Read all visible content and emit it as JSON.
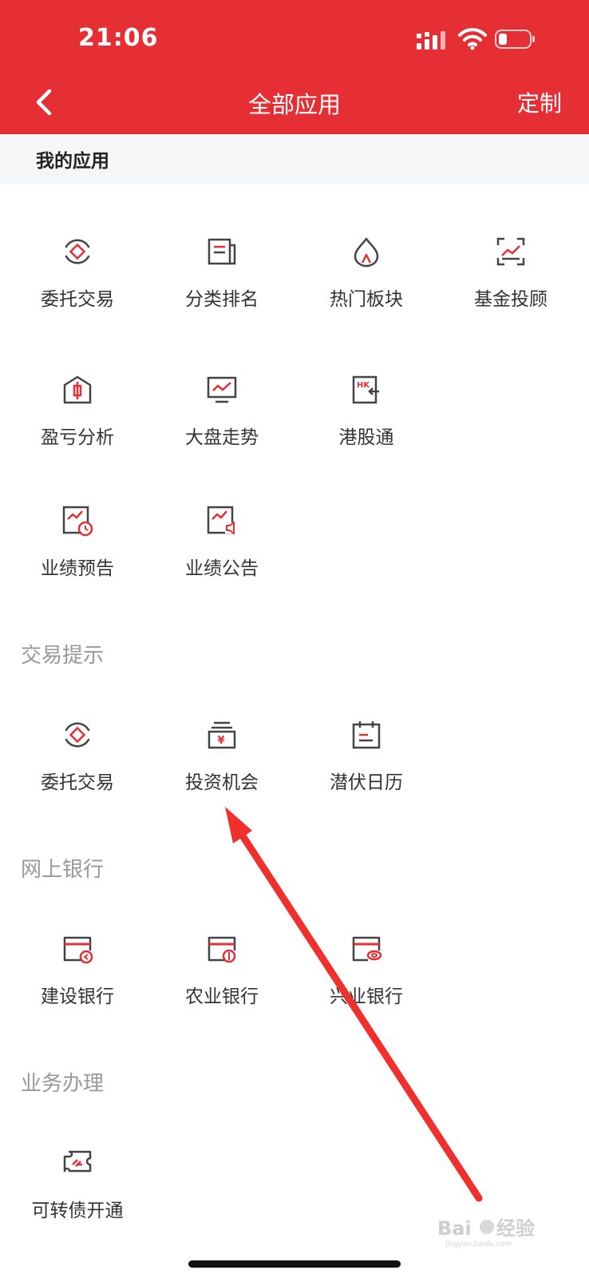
{
  "status": {
    "time": "21:06"
  },
  "header": {
    "title": "全部应用",
    "action": "定制"
  },
  "my_apps": {
    "title": "我的应用",
    "items": [
      {
        "label": "委托交易",
        "icon": "entrust-icon"
      },
      {
        "label": "分类排名",
        "icon": "ranking-icon"
      },
      {
        "label": "热门板块",
        "icon": "hot-sector-icon"
      },
      {
        "label": "基金投顾",
        "icon": "fund-advisor-icon"
      },
      {
        "label": "盈亏分析",
        "icon": "profit-analysis-icon"
      },
      {
        "label": "大盘走势",
        "icon": "market-trend-icon"
      },
      {
        "label": "港股通",
        "icon": "hk-connect-icon"
      },
      {
        "label": "业绩预告",
        "icon": "earnings-forecast-icon"
      },
      {
        "label": "业绩公告",
        "icon": "earnings-announcement-icon"
      }
    ]
  },
  "trade_tips": {
    "title": "交易提示",
    "items": [
      {
        "label": "委托交易",
        "icon": "entrust-icon"
      },
      {
        "label": "投资机会",
        "icon": "investment-opportunity-icon"
      },
      {
        "label": "潜伏日历",
        "icon": "calendar-icon"
      }
    ]
  },
  "online_banking": {
    "title": "网上银行",
    "items": [
      {
        "label": "建设银行",
        "icon": "ccb-card-icon"
      },
      {
        "label": "农业银行",
        "icon": "abc-card-icon"
      },
      {
        "label": "兴业银行",
        "icon": "cib-card-icon"
      }
    ]
  },
  "business": {
    "title": "业务办理",
    "items": [
      {
        "label": "可转债开通",
        "icon": "convertible-bond-icon"
      }
    ]
  },
  "watermark": {
    "text": "Baidu经验",
    "sub": "jingyan.baidu.com"
  },
  "colors": {
    "brand": "#e62f35",
    "icon_stroke": "#444444",
    "icon_accent": "#e62f35",
    "section_text": "#999999"
  }
}
